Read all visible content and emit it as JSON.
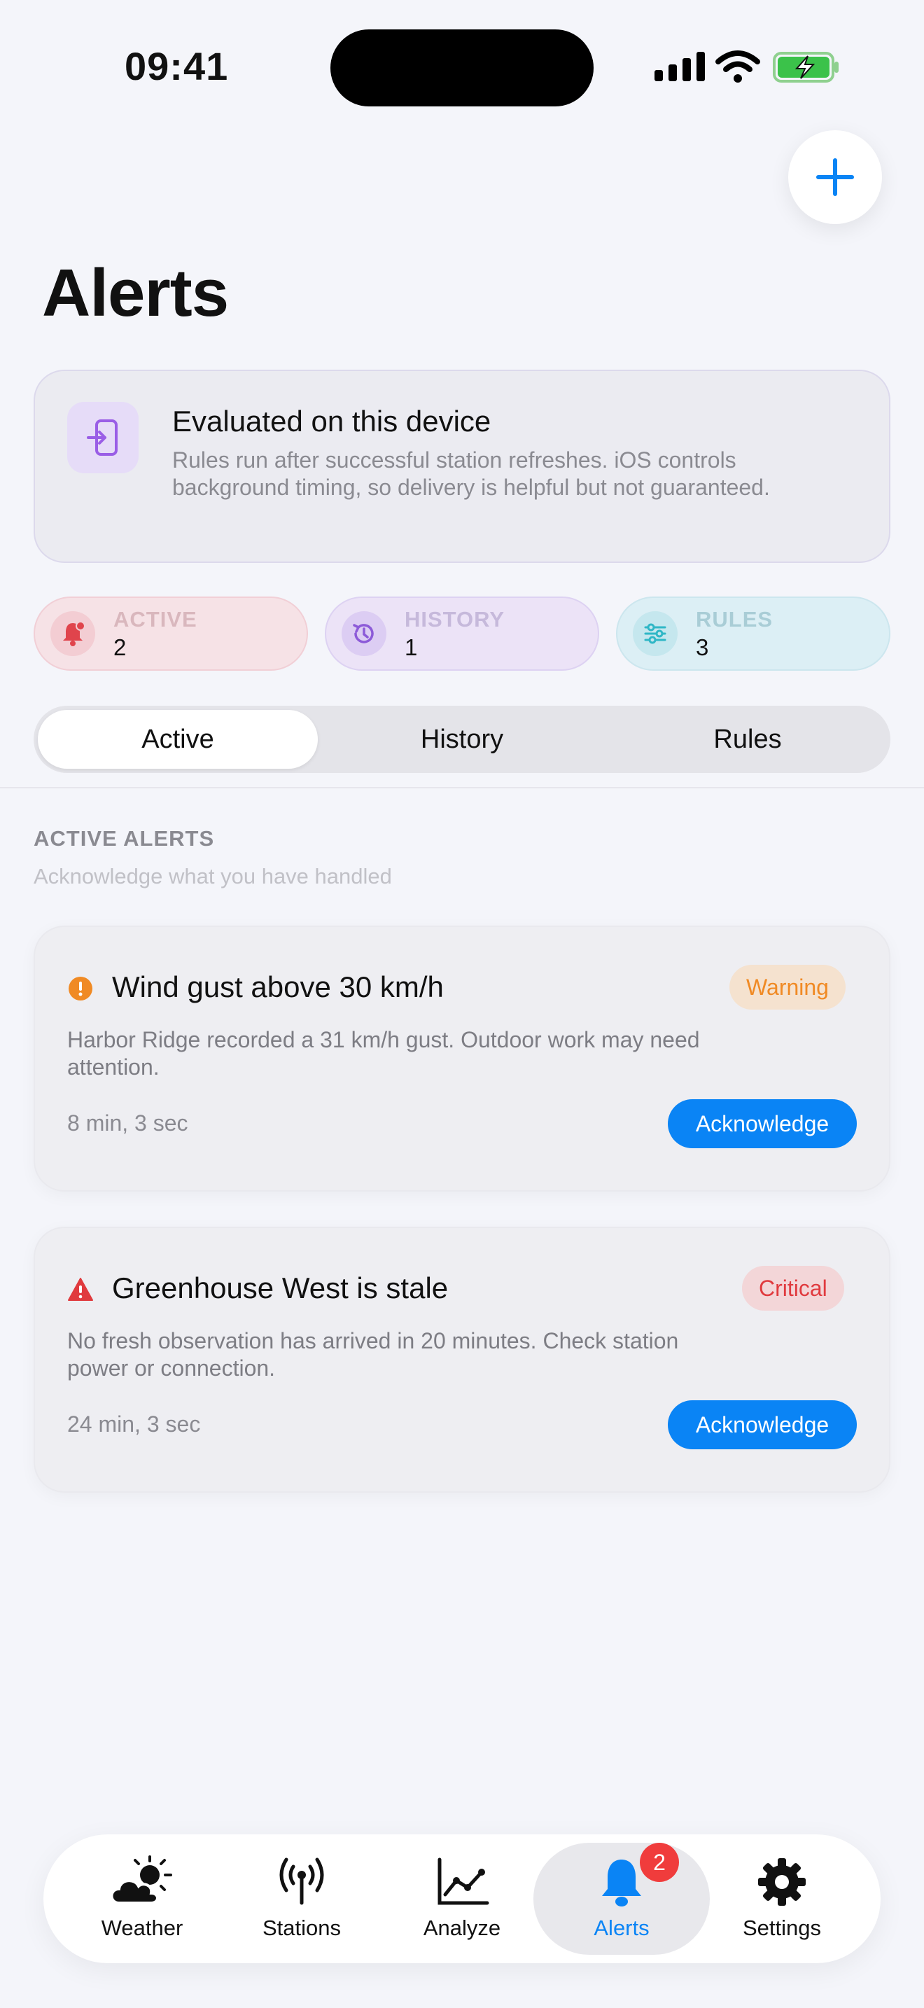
{
  "status_bar": {
    "time": "09:41"
  },
  "header": {
    "title": "Alerts"
  },
  "info_card": {
    "title": "Evaluated on this device",
    "body": "Rules run after successful station refreshes. iOS controls background timing, so delivery is helpful but not guaranteed."
  },
  "stats": {
    "active": {
      "label": "ACTIVE",
      "value": "2"
    },
    "history": {
      "label": "HISTORY",
      "value": "1"
    },
    "rules": {
      "label": "RULES",
      "value": "3"
    }
  },
  "segments": {
    "active": "Active",
    "history": "History",
    "rules": "Rules"
  },
  "section": {
    "title": "ACTIVE ALERTS",
    "subtitle": "Acknowledge what you have handled"
  },
  "alerts": [
    {
      "title": "Wind gust above 30 km/h",
      "severity": "Warning",
      "body": "Harbor Ridge recorded a 31 km/h gust. Outdoor work may need attention.",
      "time": "8 min, 3 sec",
      "action": "Acknowledge"
    },
    {
      "title": "Greenhouse West is stale",
      "severity": "Critical",
      "body": "No fresh observation has arrived in 20 minutes. Check station power or connection.",
      "time": "24 min, 3 sec",
      "action": "Acknowledge"
    }
  ],
  "tabbar": {
    "weather": "Weather",
    "stations": "Stations",
    "analyze": "Analyze",
    "alerts": "Alerts",
    "settings": "Settings",
    "alerts_badge": "2"
  },
  "colors": {
    "accent": "#0a84f5",
    "warning": "#f08a24",
    "critical": "#e03a3e"
  }
}
